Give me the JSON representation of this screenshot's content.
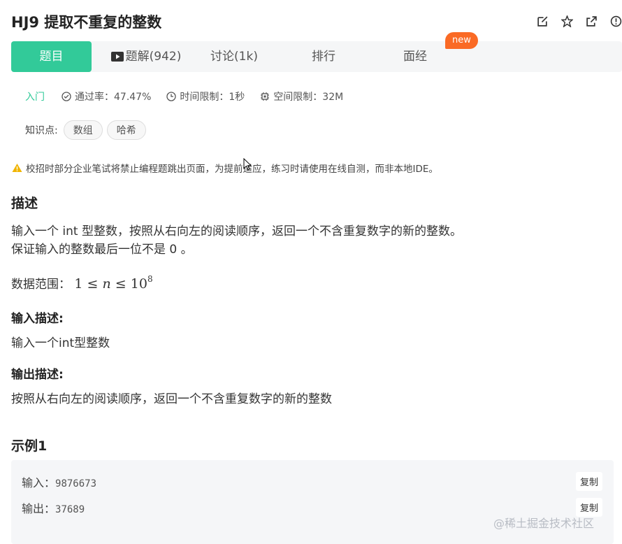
{
  "header": {
    "title": "HJ9  提取不重复的整数"
  },
  "tabs": [
    {
      "label": "题目"
    },
    {
      "label": "题解(942)"
    },
    {
      "label": "讨论(1k)"
    },
    {
      "label": "排行"
    },
    {
      "label": "面经"
    }
  ],
  "badge": {
    "new": "new"
  },
  "meta": {
    "level": "入门",
    "pass_rate": "通过率：47.47%",
    "time_limit": "时间限制：1秒",
    "space_limit": "空间限制：32M"
  },
  "knowledge": {
    "label": "知识点:",
    "tags": [
      "数组",
      "哈希"
    ]
  },
  "notice": "校招时部分企业笔试将禁止编程题跳出页面，为提前适应，练习时请使用在线自测，而非本地IDE。",
  "description": {
    "heading": "描述",
    "line1": "输入一个 int 型整数，按照从右向左的阅读顺序，返回一个不含重复数字的新的整数。",
    "line2": "保证输入的整数最后一位不是 0 。",
    "range_label": "数据范围：",
    "range_lhs": "1 ≤ ",
    "range_var": "n",
    "range_rhs": " ≤ 10",
    "range_exp": "8"
  },
  "input_desc": {
    "heading": "输入描述:",
    "text": "输入一个int型整数"
  },
  "output_desc": {
    "heading": "输出描述:",
    "text": "按照从右向左的阅读顺序，返回一个不含重复数字的新的整数"
  },
  "example": {
    "heading": "示例1",
    "input_label": "输入：",
    "input_value": "9876673",
    "output_label": "输出：",
    "output_value": "37689",
    "copy_label": "复制"
  },
  "watermark": "@稀土掘金技术社区",
  "colors": {
    "accent": "#32ca99",
    "badge": "#fa6a25",
    "warning": "#f0b400"
  }
}
